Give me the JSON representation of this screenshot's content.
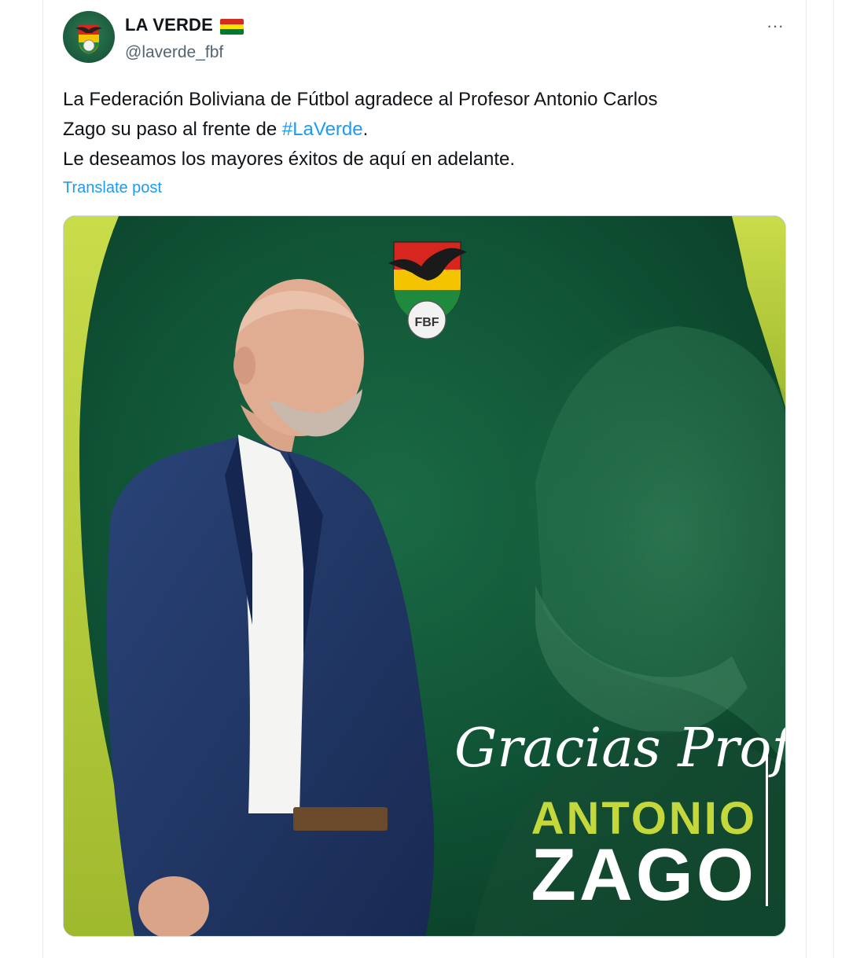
{
  "post": {
    "author": {
      "display_name": "LA VERDE",
      "handle": "@laverde_fbf"
    },
    "text_lines": [
      "La Federación Boliviana de Fútbol agradece al Profesor Antonio Carlos",
      "Zago su paso al frente de ",
      "Le deseamos los mayores éxitos de aquí en adelante."
    ],
    "hashtag": "#LaVerde",
    "after_hashtag": ".",
    "translate_label": "Translate post",
    "more_label": "···"
  },
  "media": {
    "gracias_text": "Gracias Profe",
    "first_name": "ANTONIO",
    "last_name": "ZAGO",
    "crest_letters": "FBF"
  },
  "colors": {
    "deep_green": "#0e4a30",
    "lime": "#b5cc3a",
    "link_blue": "#1d9bf0",
    "suit_navy": "#1d2f5a"
  }
}
